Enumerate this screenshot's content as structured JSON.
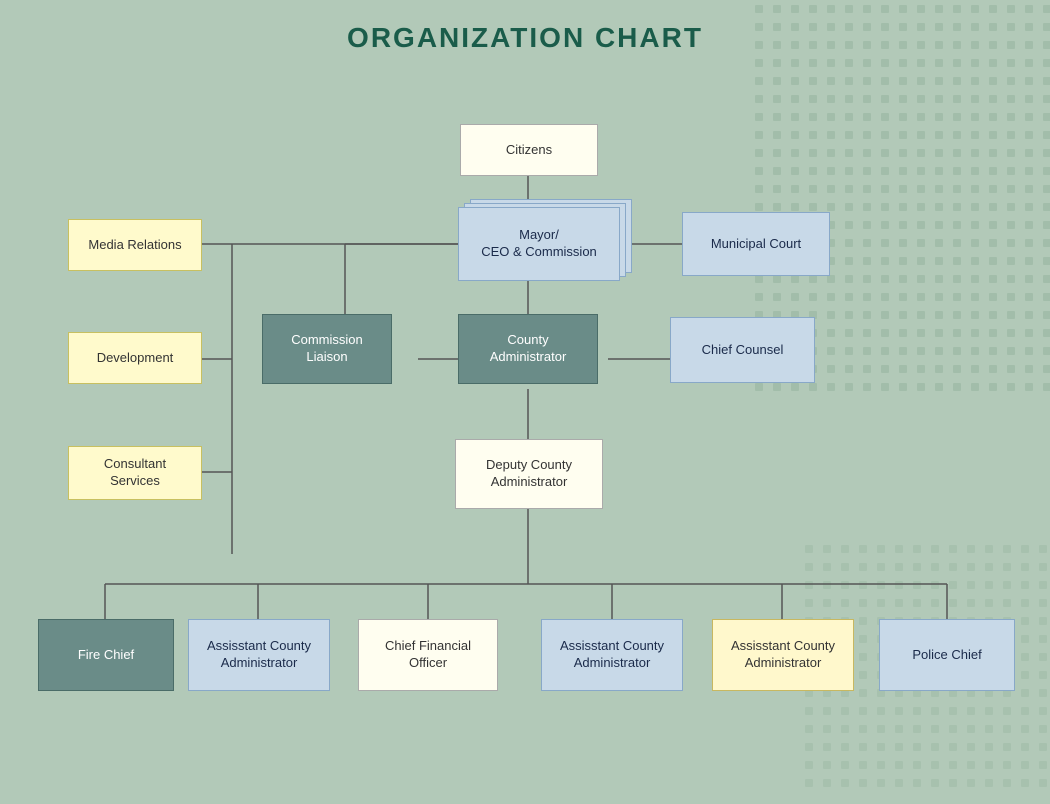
{
  "title": "ORGANIZATION CHART",
  "boxes": {
    "citizens": {
      "label": "Citizens"
    },
    "mayor": {
      "label": "Mayor/\nCEO & Commission"
    },
    "municipal_court": {
      "label": "Municipal Court"
    },
    "media_relations": {
      "label": "Media Relations"
    },
    "development": {
      "label": "Development"
    },
    "consultant_services": {
      "label": "Consultant\nServices"
    },
    "commission_liaison": {
      "label": "Commission\nLiaison"
    },
    "county_admin": {
      "label": "County\nAdministrator"
    },
    "chief_counsel": {
      "label": "Chief Counsel"
    },
    "deputy_county_admin": {
      "label": "Deputy County\nAdministrator"
    },
    "fire_chief": {
      "label": "Fire Chief"
    },
    "asst_admin_1": {
      "label": "Assisstant County\nAdministrator"
    },
    "cfo": {
      "label": "Chief Financial\nOfficer"
    },
    "asst_admin_2": {
      "label": "Assisstant County\nAdministrator"
    },
    "asst_admin_3": {
      "label": "Assisstant County\nAdministrator"
    },
    "police_chief": {
      "label": "Police Chief"
    }
  }
}
